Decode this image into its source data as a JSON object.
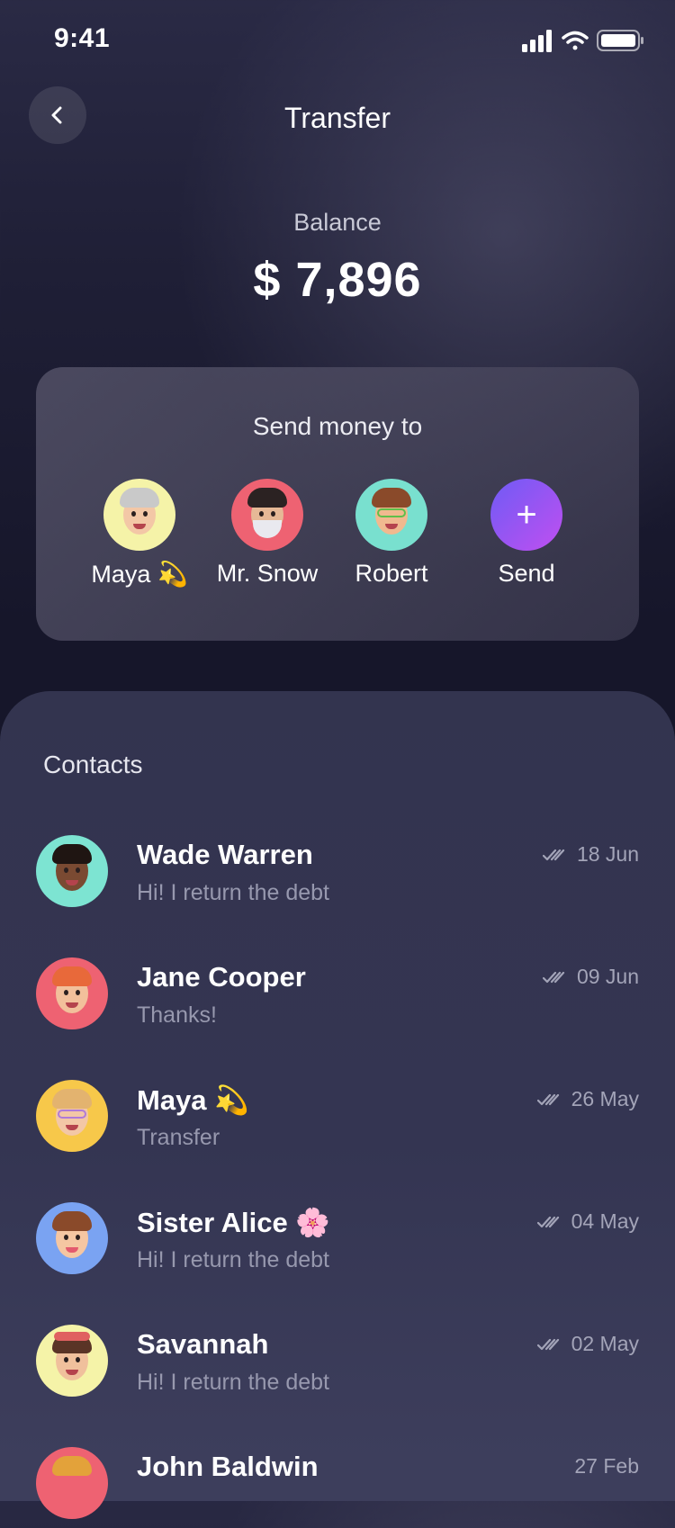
{
  "status_bar": {
    "time": "9:41"
  },
  "header": {
    "title": "Transfer",
    "back_icon": "chevron-left-icon"
  },
  "balance": {
    "label": "Balance",
    "amount": "$ 7,896"
  },
  "send_card": {
    "title": "Send money to",
    "recipients": [
      {
        "name": "Maya 💫",
        "avatar_bg": "#f5f3a8"
      },
      {
        "name": "Mr. Snow",
        "avatar_bg": "#ee6272"
      },
      {
        "name": "Robert",
        "avatar_bg": "#79e0cf"
      }
    ],
    "add": {
      "label": "Send",
      "icon": "plus-icon",
      "symbol": "+"
    }
  },
  "contacts": {
    "title": "Contacts",
    "items": [
      {
        "name": "Wade Warren",
        "message": "Hi! I return the debt",
        "date": "18 Jun",
        "avatar_bg": "#7de4d2"
      },
      {
        "name": "Jane Cooper",
        "message": "Thanks!",
        "date": "09 Jun",
        "avatar_bg": "#ee6272"
      },
      {
        "name": "Maya 💫",
        "message": "Transfer",
        "date": "26 May",
        "avatar_bg": "#f7c84a"
      },
      {
        "name": "Sister Alice 🌸",
        "message": "Hi! I return the debt",
        "date": "04 May",
        "avatar_bg": "#7aa3f2"
      },
      {
        "name": "Savannah",
        "message": "Hi! I return the debt",
        "date": "02 May",
        "avatar_bg": "#f5f3a8"
      },
      {
        "name": "John Baldwin",
        "message": "",
        "date": "27 Feb",
        "avatar_bg": "#ee6272"
      }
    ]
  }
}
